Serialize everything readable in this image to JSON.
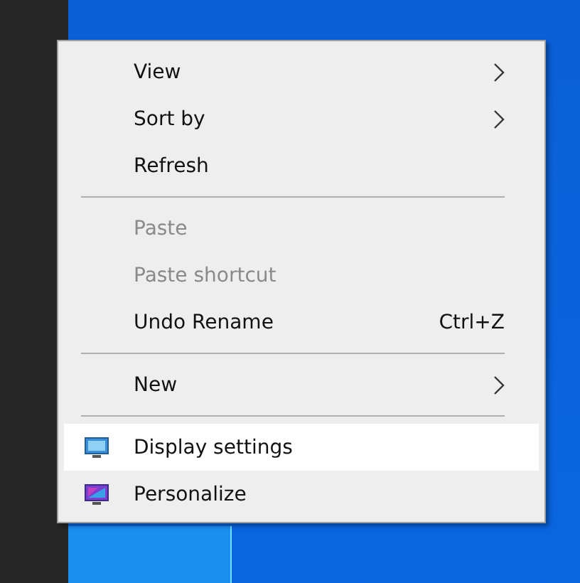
{
  "context_menu": {
    "entries": [
      {
        "kind": "item",
        "label": "View",
        "disabled": false,
        "submenu": true,
        "selected": false
      },
      {
        "kind": "item",
        "label": "Sort by",
        "disabled": false,
        "submenu": true,
        "selected": false
      },
      {
        "kind": "item",
        "label": "Refresh",
        "disabled": false,
        "submenu": false,
        "selected": false
      },
      {
        "kind": "separator"
      },
      {
        "kind": "item",
        "label": "Paste",
        "disabled": true,
        "submenu": false,
        "selected": false
      },
      {
        "kind": "item",
        "label": "Paste shortcut",
        "disabled": true,
        "submenu": false,
        "selected": false
      },
      {
        "kind": "item",
        "label": "Undo Rename",
        "shortcut": "Ctrl+Z",
        "disabled": false,
        "submenu": false,
        "selected": false
      },
      {
        "kind": "separator"
      },
      {
        "kind": "item",
        "label": "New",
        "disabled": false,
        "submenu": true,
        "selected": false
      },
      {
        "kind": "separator"
      },
      {
        "kind": "item",
        "label": "Display settings",
        "icon": true,
        "disabled": false,
        "submenu": false,
        "selected": true
      },
      {
        "kind": "item",
        "label": "Personalize",
        "icon": true,
        "disabled": false,
        "submenu": false,
        "selected": false
      }
    ]
  }
}
